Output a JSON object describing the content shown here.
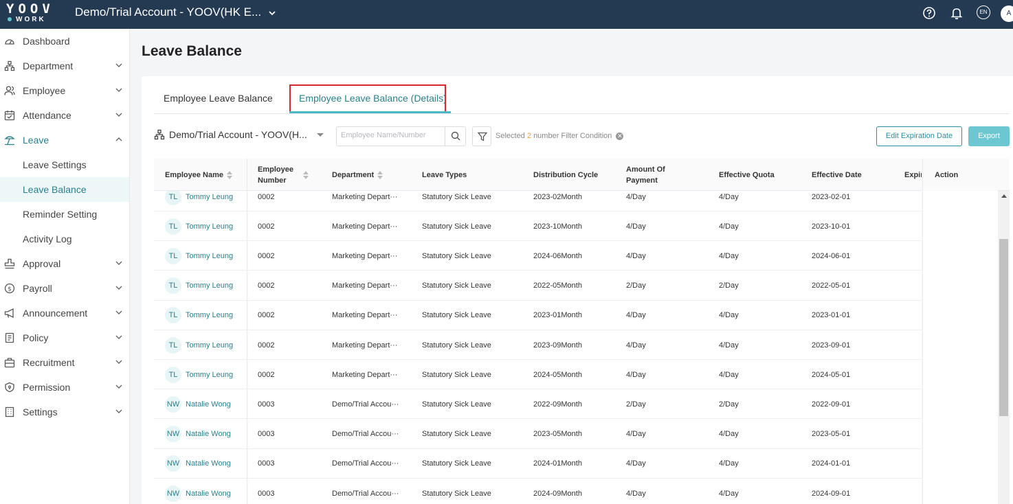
{
  "topbar": {
    "logo_top": "YOOV",
    "logo_bottom": "WORK",
    "company": "Demo/Trial Account - YOOV(HK E...",
    "lang": "EN",
    "avatar": "A"
  },
  "sidebar": {
    "items": [
      {
        "label": "Dashboard",
        "icon": "dashboard-icon"
      },
      {
        "label": "Department",
        "icon": "department-icon"
      },
      {
        "label": "Employee",
        "icon": "employee-icon"
      },
      {
        "label": "Attendance",
        "icon": "attendance-icon"
      },
      {
        "label": "Leave",
        "icon": "leave-icon"
      },
      {
        "label": "Leave Settings"
      },
      {
        "label": "Leave Balance"
      },
      {
        "label": "Reminder Setting"
      },
      {
        "label": "Activity Log"
      },
      {
        "label": "Approval",
        "icon": "approval-icon"
      },
      {
        "label": "Payroll",
        "icon": "payroll-icon"
      },
      {
        "label": "Announcement",
        "icon": "announcement-icon"
      },
      {
        "label": "Policy",
        "icon": "policy-icon"
      },
      {
        "label": "Recruitment",
        "icon": "recruitment-icon"
      },
      {
        "label": "Permission",
        "icon": "permission-icon"
      },
      {
        "label": "Settings",
        "icon": "settings-icon"
      }
    ]
  },
  "page": {
    "title": "Leave Balance",
    "tabs": [
      "Employee Leave Balance",
      "Employee Leave Balance (Details)"
    ]
  },
  "toolbar": {
    "org": "Demo/Trial Account - YOOV(H...",
    "search_placeholder": "Employee Name/Number",
    "filter_prefix": "Selected",
    "filter_count": "2",
    "filter_suffix": "number Filter Condition",
    "edit_expiration": "Edit Expiration Date",
    "export": "Export"
  },
  "table": {
    "headers": {
      "name": "Employee Name",
      "number_1": "Employee",
      "number_2": "Number",
      "department": "Department",
      "leave_types": "Leave Types",
      "cycle": "Distribution Cycle",
      "amount_1": "Amount Of",
      "amount_2": "Payment",
      "quota": "Effective Quota",
      "date": "Effective Date",
      "expiry": "Expir",
      "action": "Action"
    },
    "rows": [
      {
        "initials": "TL",
        "name": "Tommy Leung",
        "number": "0002",
        "department": "Marketing Depart···",
        "leave_type": "Statutory Sick Leave",
        "cycle": "2023-02Month",
        "amount": "4/Day",
        "quota": "4/Day",
        "date": "2023-02-01"
      },
      {
        "initials": "TL",
        "name": "Tommy Leung",
        "number": "0002",
        "department": "Marketing Depart···",
        "leave_type": "Statutory Sick Leave",
        "cycle": "2023-10Month",
        "amount": "4/Day",
        "quota": "4/Day",
        "date": "2023-10-01"
      },
      {
        "initials": "TL",
        "name": "Tommy Leung",
        "number": "0002",
        "department": "Marketing Depart···",
        "leave_type": "Statutory Sick Leave",
        "cycle": "2024-06Month",
        "amount": "4/Day",
        "quota": "4/Day",
        "date": "2024-06-01"
      },
      {
        "initials": "TL",
        "name": "Tommy Leung",
        "number": "0002",
        "department": "Marketing Depart···",
        "leave_type": "Statutory Sick Leave",
        "cycle": "2022-05Month",
        "amount": "2/Day",
        "quota": "2/Day",
        "date": "2022-05-01"
      },
      {
        "initials": "TL",
        "name": "Tommy Leung",
        "number": "0002",
        "department": "Marketing Depart···",
        "leave_type": "Statutory Sick Leave",
        "cycle": "2023-01Month",
        "amount": "4/Day",
        "quota": "4/Day",
        "date": "2023-01-01"
      },
      {
        "initials": "TL",
        "name": "Tommy Leung",
        "number": "0002",
        "department": "Marketing Depart···",
        "leave_type": "Statutory Sick Leave",
        "cycle": "2023-09Month",
        "amount": "4/Day",
        "quota": "4/Day",
        "date": "2023-09-01"
      },
      {
        "initials": "TL",
        "name": "Tommy Leung",
        "number": "0002",
        "department": "Marketing Depart···",
        "leave_type": "Statutory Sick Leave",
        "cycle": "2024-05Month",
        "amount": "4/Day",
        "quota": "4/Day",
        "date": "2024-05-01"
      },
      {
        "initials": "NW",
        "name": "Natalie Wong",
        "number": "0003",
        "department": "Demo/Trial Accou···",
        "leave_type": "Statutory Sick Leave",
        "cycle": "2022-09Month",
        "amount": "2/Day",
        "quota": "2/Day",
        "date": "2022-09-01"
      },
      {
        "initials": "NW",
        "name": "Natalie Wong",
        "number": "0003",
        "department": "Demo/Trial Accou···",
        "leave_type": "Statutory Sick Leave",
        "cycle": "2023-05Month",
        "amount": "4/Day",
        "quota": "4/Day",
        "date": "2023-05-01"
      },
      {
        "initials": "NW",
        "name": "Natalie Wong",
        "number": "0003",
        "department": "Demo/Trial Accou···",
        "leave_type": "Statutory Sick Leave",
        "cycle": "2024-01Month",
        "amount": "4/Day",
        "quota": "4/Day",
        "date": "2024-01-01"
      },
      {
        "initials": "NW",
        "name": "Natalie Wong",
        "number": "0003",
        "department": "Demo/Trial Accou···",
        "leave_type": "Statutory Sick Leave",
        "cycle": "2024-09Month",
        "amount": "4/Day",
        "quota": "4/Day",
        "date": "2024-09-01"
      }
    ]
  },
  "colors": {
    "topbar": "#243a52",
    "accent": "#2a7f8a",
    "highlight_box": "#d9262f",
    "export": "#6dc7d0"
  }
}
